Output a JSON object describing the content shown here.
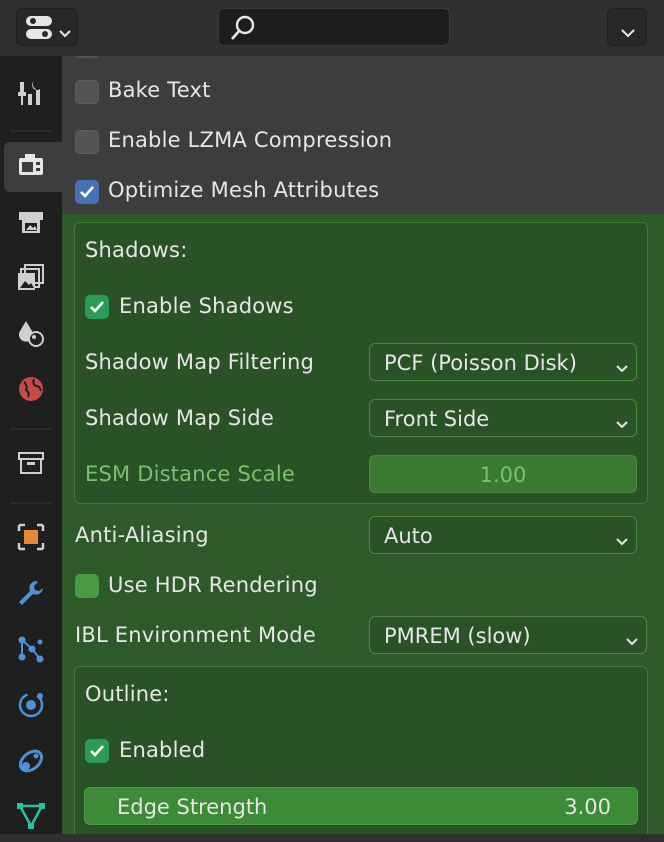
{
  "topbar": {
    "editor_type_icon": "editor-type-icon",
    "search": {
      "value": "",
      "placeholder": ""
    },
    "options_icon": "chevron-down-icon"
  },
  "tabs": [
    {
      "name": "tool-icon",
      "active": false
    },
    {
      "name": "render-icon",
      "active": true
    },
    {
      "name": "output-icon",
      "active": false
    },
    {
      "name": "view-layer-icon",
      "active": false
    },
    {
      "name": "scene-icon",
      "active": false
    },
    {
      "name": "world-icon",
      "active": false
    },
    {
      "name": "collection-icon",
      "active": false
    },
    {
      "name": "object-icon",
      "active": false
    },
    {
      "name": "modifier-icon",
      "active": false
    },
    {
      "name": "particles-icon",
      "active": false
    },
    {
      "name": "physics-icon",
      "active": false
    },
    {
      "name": "constraints-icon",
      "active": false
    },
    {
      "name": "data-icon",
      "active": false
    }
  ],
  "export_options": {
    "bake_text": {
      "label": "Bake Text",
      "checked": false
    },
    "lzma": {
      "label": "Enable LZMA Compression",
      "checked": false
    },
    "optimize_mesh": {
      "label": "Optimize Mesh Attributes",
      "checked": true
    }
  },
  "shadows": {
    "title": "Shadows:",
    "enable": {
      "label": "Enable Shadows",
      "checked": true
    },
    "filtering": {
      "label": "Shadow Map Filtering",
      "value": "PCF (Poisson Disk)"
    },
    "side": {
      "label": "Shadow Map Side",
      "value": "Front Side"
    },
    "esm_scale": {
      "label": "ESM Distance Scale",
      "value": "1.00"
    }
  },
  "anti_aliasing": {
    "label": "Anti-Aliasing",
    "value": "Auto"
  },
  "hdr": {
    "label": "Use HDR Rendering",
    "checked": false
  },
  "ibl": {
    "label": "IBL Environment Mode",
    "value": "PMREM (slow)"
  },
  "outline": {
    "title": "Outline:",
    "enabled": {
      "label": "Enabled",
      "checked": true
    },
    "edge_strength": {
      "label": "Edge Strength",
      "value": "3.00"
    }
  },
  "colors": {
    "accent_blue": "#4772b3",
    "green_section": "#2e5a2a",
    "check_green": "#2d9a58"
  }
}
